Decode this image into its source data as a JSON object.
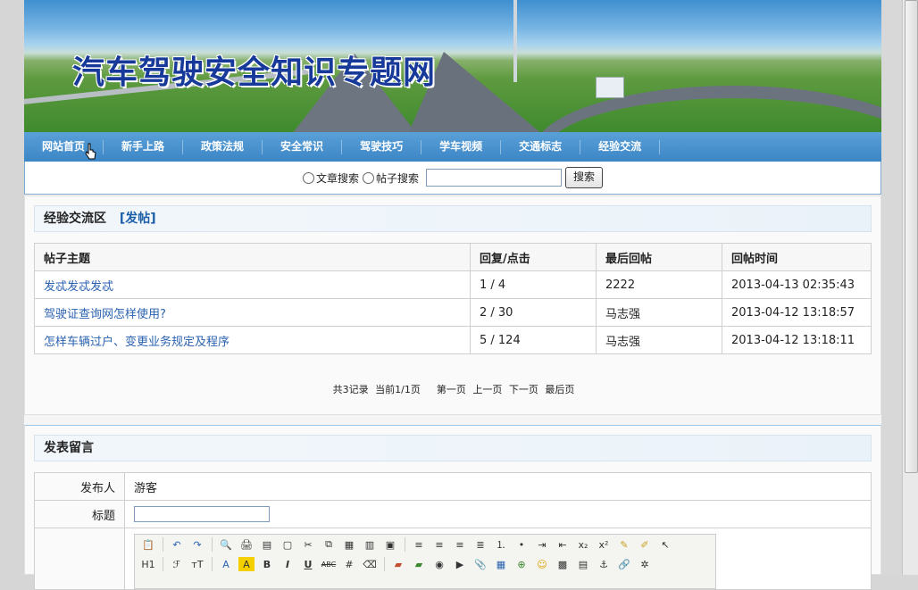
{
  "banner": {
    "title": "汽车驾驶安全知识专题网"
  },
  "nav": {
    "items": [
      "网站首页",
      "新手上路",
      "政策法规",
      "安全常识",
      "驾驶技巧",
      "学车视频",
      "交通标志",
      "经验交流"
    ]
  },
  "search": {
    "options": [
      "文章搜索",
      "帖子搜索"
    ],
    "button": "搜索",
    "value": ""
  },
  "forum": {
    "title": "经验交流区",
    "post_link": "[发帖]",
    "headers": [
      "帖子主题",
      "回复/点击",
      "最后回帖",
      "回帖时间"
    ],
    "rows": [
      {
        "topic": "发忒发忒发忒",
        "stats": "1 / 4",
        "last": "2222",
        "time": "2013-04-13 02:35:43"
      },
      {
        "topic": "驾驶证查询网怎样使用?",
        "stats": "2 / 30",
        "last": "马志强",
        "time": "2013-04-12 13:18:57"
      },
      {
        "topic": "怎样车辆过户、变更业务规定及程序",
        "stats": "5 / 124",
        "last": "马志强",
        "time": "2013-04-12 13:18:11"
      }
    ],
    "pager": {
      "summary": "共3记录",
      "current": "当前1/1页",
      "first": "第一页",
      "prev": "上一页",
      "next": "下一页",
      "last": "最后页"
    }
  },
  "comment": {
    "title": "发表留言",
    "author_label": "发布人",
    "author_value": "游客",
    "subject_label": "标题",
    "subject_value": ""
  },
  "editor_toolbar": {
    "row1": [
      "paste-icon",
      "undo-icon",
      "redo-icon",
      "preview-icon",
      "print-icon",
      "template-icon",
      "source-icon",
      "cut-icon",
      "copy-icon",
      "paste-text-icon",
      "paste-word-icon",
      "select-all-icon",
      "align-left-icon",
      "align-center-icon",
      "align-right-icon",
      "justify-icon",
      "ordered-list-icon",
      "unordered-list-icon",
      "indent-icon",
      "outdent-icon",
      "subscript-icon",
      "superscript-icon",
      "clear-format-icon",
      "quick-format-icon",
      "select-icon"
    ],
    "row2_labels": {
      "heading": "H1",
      "font": "ℱ",
      "size": "тT",
      "fontcolor": "A",
      "highlight": "A",
      "bold": "B",
      "italic": "I",
      "underline": "U",
      "strike": "ABC"
    }
  }
}
